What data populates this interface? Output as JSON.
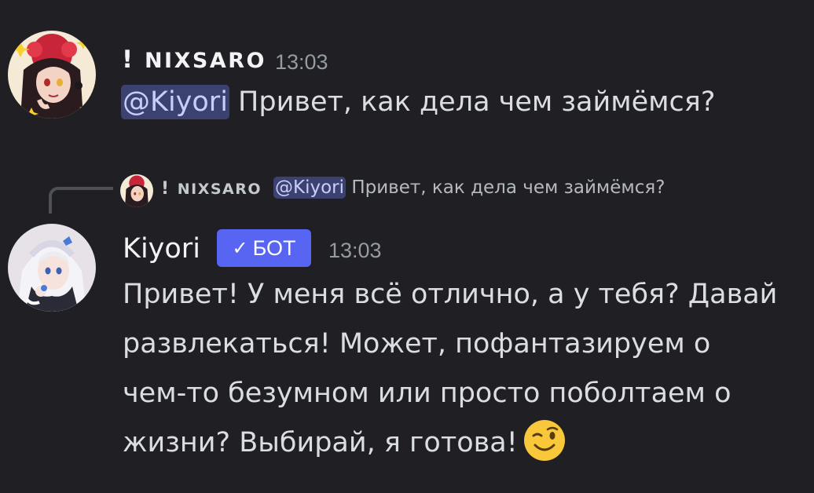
{
  "message1": {
    "author_prefix": "!",
    "author_name": "NIXSARO",
    "timestamp": "13:03",
    "mention": "@Kiyori",
    "text": " Привет, как дела чем займёмся?",
    "avatar_icon": "anime-girl-avatar-icon"
  },
  "reply": {
    "author_prefix": "!",
    "author_name": "NIXSARO",
    "mention": "@Kiyori",
    "text": " Привет, как дела чем займёмся?"
  },
  "message2": {
    "author_name": "Kiyori",
    "bot_badge": "БОТ",
    "timestamp": "13:03",
    "lines": [
      "Привет! У меня всё отлично, а у тебя? Давай",
      "развлекаться! Может, пофантазируем о",
      "чем-то безумном или просто поболтаем о",
      "жизни? Выбирай, я готова!"
    ],
    "emoji": "winking-face-emoji",
    "avatar_icon": "anime-girl-white-hair-avatar-icon"
  },
  "colors": {
    "background": "#1f1f24",
    "mention_bg": "#3c4270",
    "mention_fg": "#c9cdfb",
    "bot_badge": "#5865f2",
    "timestamp": "#949ba4"
  }
}
